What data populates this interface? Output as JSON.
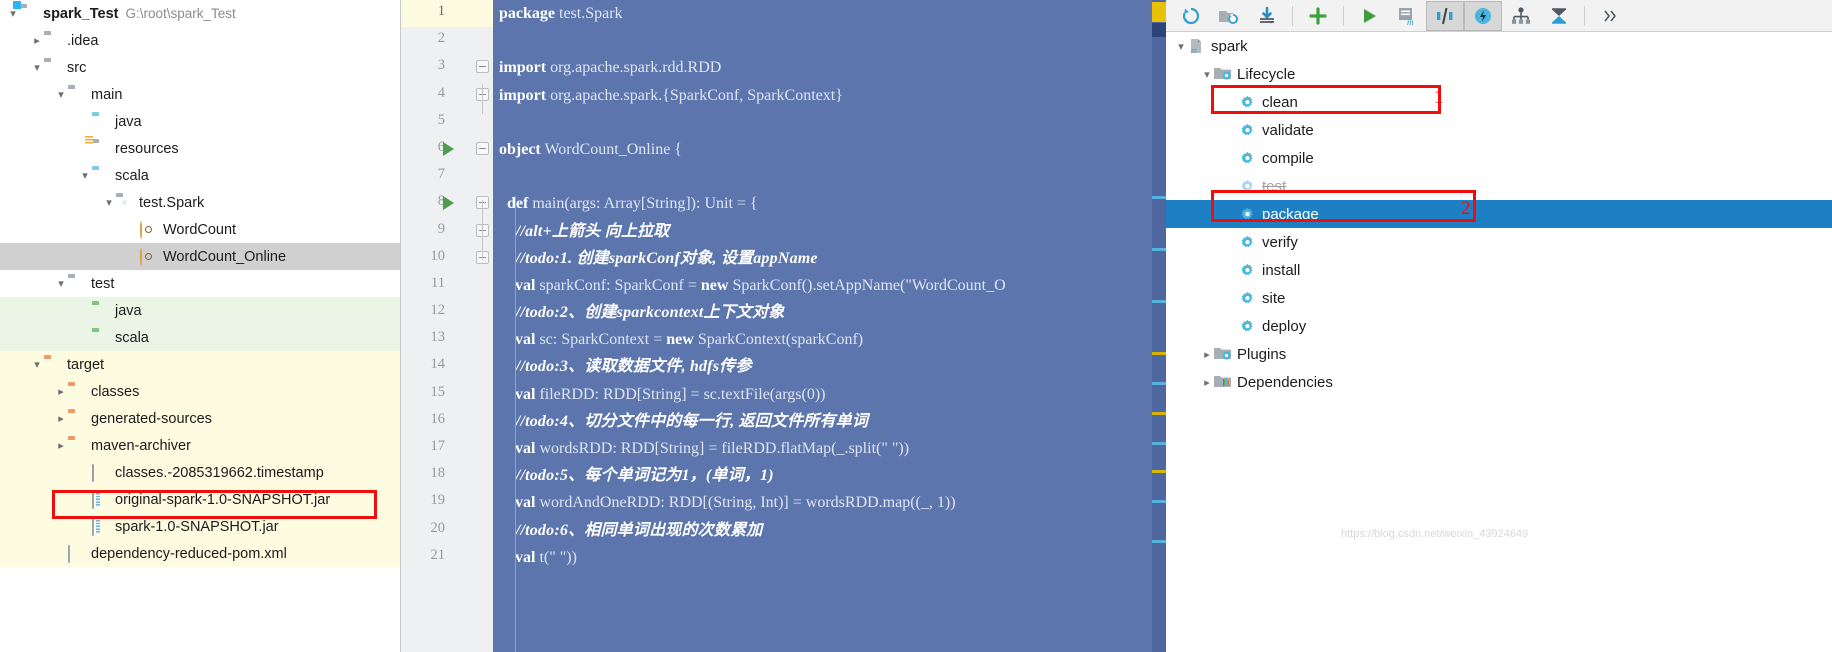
{
  "project_tree": {
    "rows": [
      {
        "indent": 0,
        "arrow": "v",
        "icon": "module-folder",
        "label": "spark_Test",
        "bold": true,
        "path": "G:\\root\\spark_Test",
        "bg": "none"
      },
      {
        "indent": 1,
        "arrow": ">",
        "icon": "folder-gray",
        "label": ".idea",
        "bold": false,
        "path": "",
        "bg": "none"
      },
      {
        "indent": 1,
        "arrow": "v",
        "icon": "folder-gray",
        "label": "src",
        "bold": false,
        "path": "",
        "bg": "none"
      },
      {
        "indent": 2,
        "arrow": "v",
        "icon": "folder-gray",
        "label": "main",
        "bold": false,
        "path": "",
        "bg": "none"
      },
      {
        "indent": 3,
        "arrow": "",
        "icon": "folder-blue",
        "label": "java",
        "bold": false,
        "path": "",
        "bg": "none"
      },
      {
        "indent": 3,
        "arrow": "",
        "icon": "folder-resources",
        "label": "resources",
        "bold": false,
        "path": "",
        "bg": "none"
      },
      {
        "indent": 3,
        "arrow": "v",
        "icon": "folder-blue",
        "label": "scala",
        "bold": false,
        "path": "",
        "bg": "none"
      },
      {
        "indent": 4,
        "arrow": "v",
        "icon": "package",
        "label": "test.Spark",
        "bold": false,
        "path": "",
        "bg": "none"
      },
      {
        "indent": 5,
        "arrow": "",
        "icon": "scala-object",
        "label": "WordCount",
        "bold": false,
        "path": "",
        "bg": "none"
      },
      {
        "indent": 5,
        "arrow": "",
        "icon": "scala-object",
        "label": "WordCount_Online",
        "bold": false,
        "path": "",
        "bg": "selected"
      },
      {
        "indent": 2,
        "arrow": "v",
        "icon": "folder-gray",
        "label": "test",
        "bold": false,
        "path": "",
        "bg": "none"
      },
      {
        "indent": 3,
        "arrow": "",
        "icon": "folder-green",
        "label": "java",
        "bold": false,
        "path": "",
        "bg": "green"
      },
      {
        "indent": 3,
        "arrow": "",
        "icon": "folder-green",
        "label": "scala",
        "bold": false,
        "path": "",
        "bg": "green"
      },
      {
        "indent": 1,
        "arrow": "v",
        "icon": "folder-orange",
        "label": "target",
        "bold": false,
        "path": "",
        "bg": "cream"
      },
      {
        "indent": 2,
        "arrow": ">",
        "icon": "folder-orange",
        "label": "classes",
        "bold": false,
        "path": "",
        "bg": "cream"
      },
      {
        "indent": 2,
        "arrow": ">",
        "icon": "folder-orange",
        "label": "generated-sources",
        "bold": false,
        "path": "",
        "bg": "cream"
      },
      {
        "indent": 2,
        "arrow": ">",
        "icon": "folder-orange",
        "label": "maven-archiver",
        "bold": false,
        "path": "",
        "bg": "cream"
      },
      {
        "indent": 3,
        "arrow": "",
        "icon": "file",
        "label": "classes.-2085319662.timestamp",
        "bold": false,
        "path": "",
        "bg": "cream"
      },
      {
        "indent": 3,
        "arrow": "",
        "icon": "jar",
        "label": "original-spark-1.0-SNAPSHOT.jar",
        "bold": false,
        "path": "",
        "bg": "cream"
      },
      {
        "indent": 3,
        "arrow": "",
        "icon": "jar",
        "label": "spark-1.0-SNAPSHOT.jar",
        "bold": false,
        "path": "",
        "bg": "cream"
      },
      {
        "indent": 2,
        "arrow": "",
        "icon": "xml",
        "label": "dependency-reduced-pom.xml",
        "bold": false,
        "path": "",
        "bg": "cream"
      }
    ]
  },
  "editor": {
    "lines": [
      {
        "n": "1",
        "run": false,
        "fold": false,
        "code": [
          {
            "t": "package",
            "c": "kw"
          },
          {
            "t": " test.Spark",
            "c": ""
          }
        ]
      },
      {
        "n": "2",
        "run": false,
        "fold": false,
        "code": []
      },
      {
        "n": "3",
        "run": false,
        "fold": true,
        "code": [
          {
            "t": "import",
            "c": "kw"
          },
          {
            "t": " org.apache.spark.rdd.RDD",
            "c": ""
          }
        ]
      },
      {
        "n": "4",
        "run": false,
        "fold": true,
        "code": [
          {
            "t": "import",
            "c": "kw"
          },
          {
            "t": " org.apache.spark.{SparkConf, SparkContext}",
            "c": ""
          }
        ]
      },
      {
        "n": "5",
        "run": false,
        "fold": false,
        "code": []
      },
      {
        "n": "6",
        "run": true,
        "fold": true,
        "code": [
          {
            "t": "object",
            "c": "kw"
          },
          {
            "t": " WordCount_Online {",
            "c": ""
          }
        ]
      },
      {
        "n": "7",
        "run": false,
        "fold": false,
        "code": []
      },
      {
        "n": "8",
        "run": true,
        "fold": true,
        "code": [
          {
            "t": "  ",
            "c": ""
          },
          {
            "t": "def",
            "c": "kw"
          },
          {
            "t": " main(args: Array[String]): Unit = {",
            "c": ""
          }
        ]
      },
      {
        "n": "9",
        "run": false,
        "fold": true,
        "code": [
          {
            "t": "    //alt+上箭头 向上拉取",
            "c": "cmt"
          }
        ]
      },
      {
        "n": "10",
        "run": false,
        "fold": true,
        "code": [
          {
            "t": "    //todo:1. 创建sparkConf对象, 设置appName",
            "c": "cmt"
          }
        ]
      },
      {
        "n": "11",
        "run": false,
        "fold": false,
        "code": [
          {
            "t": "    ",
            "c": ""
          },
          {
            "t": "val",
            "c": "kw"
          },
          {
            "t": " sparkConf: SparkConf = ",
            "c": ""
          },
          {
            "t": "new",
            "c": "kw"
          },
          {
            "t": " SparkConf().setAppName(\"WordCount_O",
            "c": ""
          }
        ]
      },
      {
        "n": "12",
        "run": false,
        "fold": false,
        "code": [
          {
            "t": "    //todo:2、创建sparkcontext上下文对象",
            "c": "cmt"
          }
        ]
      },
      {
        "n": "13",
        "run": false,
        "fold": false,
        "code": [
          {
            "t": "    ",
            "c": ""
          },
          {
            "t": "val",
            "c": "kw"
          },
          {
            "t": " sc: SparkContext = ",
            "c": ""
          },
          {
            "t": "new",
            "c": "kw"
          },
          {
            "t": " SparkContext(sparkConf)",
            "c": ""
          }
        ]
      },
      {
        "n": "14",
        "run": false,
        "fold": false,
        "code": [
          {
            "t": "    //todo:3、读取数据文件, hdfs传参",
            "c": "cmt"
          }
        ]
      },
      {
        "n": "15",
        "run": false,
        "fold": false,
        "code": [
          {
            "t": "    ",
            "c": ""
          },
          {
            "t": "val",
            "c": "kw"
          },
          {
            "t": " fileRDD: RDD[String] = sc.textFile(args(0))",
            "c": ""
          }
        ]
      },
      {
        "n": "16",
        "run": false,
        "fold": false,
        "code": [
          {
            "t": "    //todo:4、切分文件中的每一行, 返回文件所有单词",
            "c": "cmt"
          }
        ]
      },
      {
        "n": "17",
        "run": false,
        "fold": false,
        "code": [
          {
            "t": "    ",
            "c": ""
          },
          {
            "t": "val",
            "c": "kw"
          },
          {
            "t": " wordsRDD: RDD[String] = fileRDD.flatMap(_.split(\" \"))",
            "c": ""
          }
        ]
      },
      {
        "n": "18",
        "run": false,
        "fold": false,
        "code": [
          {
            "t": "    //todo:5、每个单词记为1，(单词，1)",
            "c": "cmt"
          }
        ]
      },
      {
        "n": "19",
        "run": false,
        "fold": false,
        "code": [
          {
            "t": "    ",
            "c": ""
          },
          {
            "t": "val",
            "c": "kw"
          },
          {
            "t": " wordAndOneRDD: RDD[(String, Int)] = wordsRDD.map((_, 1))",
            "c": ""
          }
        ]
      },
      {
        "n": "20",
        "run": false,
        "fold": false,
        "code": [
          {
            "t": "    //todo:6、相同单词出现的次数累加",
            "c": "cmt"
          }
        ]
      },
      {
        "n": "21",
        "run": false,
        "fold": false,
        "code": [
          {
            "t": "    ",
            "c": ""
          },
          {
            "t": "val",
            "c": "kw"
          },
          {
            "t": " t(\" \"))",
            "c": ""
          }
        ]
      }
    ]
  },
  "maven": {
    "toolbar_icons": [
      {
        "name": "reimport-icon",
        "glyph": "↻",
        "active": false
      },
      {
        "name": "generate-sources-icon",
        "glyph": "↻",
        "active": false
      },
      {
        "name": "download-sources-icon",
        "glyph": "↓",
        "active": false
      },
      {
        "name": "add-maven-project-icon",
        "glyph": "+",
        "active": false
      },
      {
        "name": "run-maven-build-icon",
        "glyph": "▶",
        "active": false
      },
      {
        "name": "execute-maven-goal-icon",
        "glyph": "m",
        "active": false
      },
      {
        "name": "toggle-offline-mode-icon",
        "glyph": "//",
        "active": true
      },
      {
        "name": "toggle-skip-tests-icon",
        "glyph": "⚡",
        "active": true
      },
      {
        "name": "show-dependencies-icon",
        "glyph": "⛬",
        "active": false
      },
      {
        "name": "collapse-all-icon",
        "glyph": "≡",
        "active": false
      },
      {
        "name": "more-options-icon",
        "glyph": "»",
        "active": false
      }
    ],
    "tree": [
      {
        "indent": 0,
        "arrow": "v",
        "icon": "maven-project-icon",
        "label": "spark",
        "state": "normal"
      },
      {
        "indent": 1,
        "arrow": "v",
        "icon": "lifecycle-folder-icon",
        "label": "Lifecycle",
        "state": "normal"
      },
      {
        "indent": 2,
        "arrow": "",
        "icon": "gear-icon",
        "label": "clean",
        "state": "normal"
      },
      {
        "indent": 2,
        "arrow": "",
        "icon": "gear-icon",
        "label": "validate",
        "state": "normal"
      },
      {
        "indent": 2,
        "arrow": "",
        "icon": "gear-icon",
        "label": "compile",
        "state": "normal"
      },
      {
        "indent": 2,
        "arrow": "",
        "icon": "gear-icon",
        "label": "test",
        "state": "skipped"
      },
      {
        "indent": 2,
        "arrow": "",
        "icon": "gear-icon",
        "label": "package",
        "state": "selected"
      },
      {
        "indent": 2,
        "arrow": "",
        "icon": "gear-icon",
        "label": "verify",
        "state": "normal"
      },
      {
        "indent": 2,
        "arrow": "",
        "icon": "gear-icon",
        "label": "install",
        "state": "normal"
      },
      {
        "indent": 2,
        "arrow": "",
        "icon": "gear-icon",
        "label": "site",
        "state": "normal"
      },
      {
        "indent": 2,
        "arrow": "",
        "icon": "gear-icon",
        "label": "deploy",
        "state": "normal"
      },
      {
        "indent": 1,
        "arrow": ">",
        "icon": "plugins-folder-icon",
        "label": "Plugins",
        "state": "normal"
      },
      {
        "indent": 1,
        "arrow": ">",
        "icon": "dependencies-folder-icon",
        "label": "Dependencies",
        "state": "normal"
      }
    ]
  },
  "annotations": {
    "marker_one": "1",
    "marker_two": "2"
  },
  "watermark": "https://blog.csdn.net/weixin_43924649",
  "colors": {
    "highlight_red": "#f20d0d",
    "selection_blue": "#1d80c4",
    "editor_bg": "#5c75ad",
    "tree_selected": "#d0d0d0"
  }
}
